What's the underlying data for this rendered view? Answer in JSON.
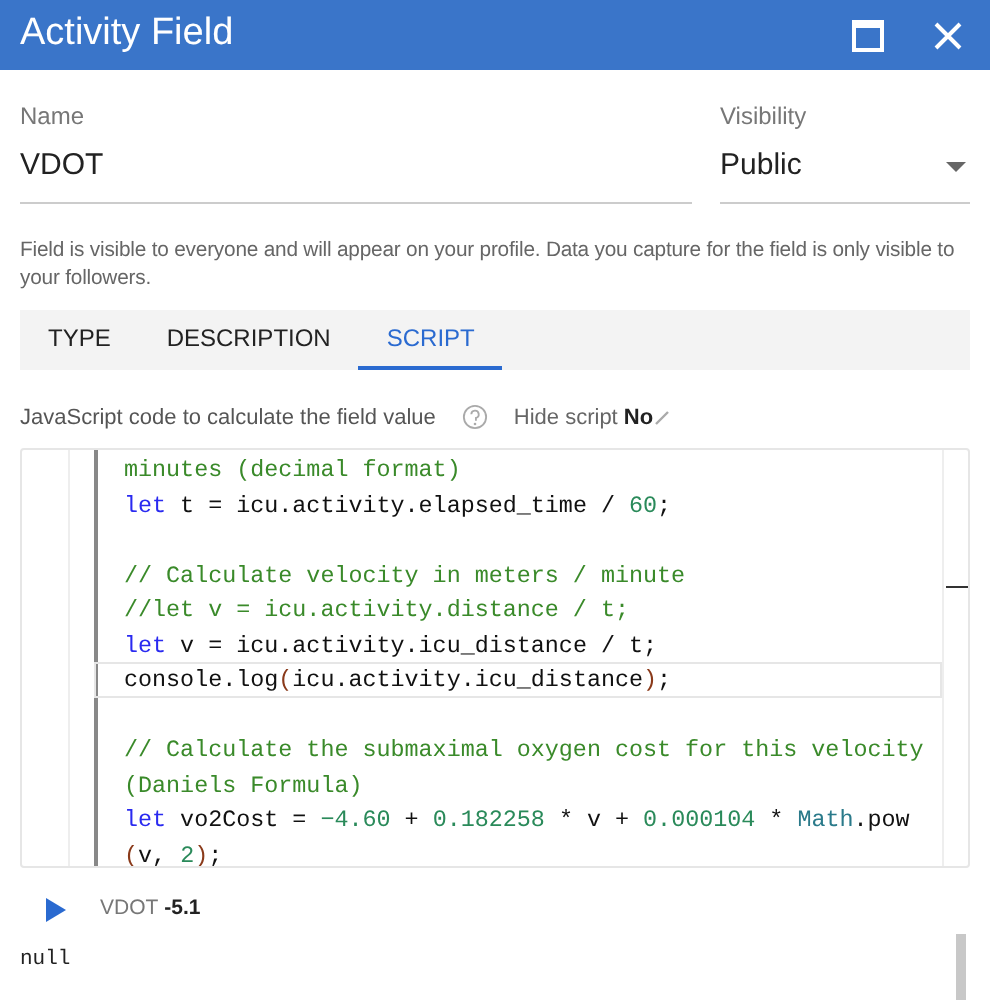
{
  "window": {
    "title": "Activity Field"
  },
  "name_field": {
    "label": "Name",
    "value": "VDOT"
  },
  "visibility_field": {
    "label": "Visibility",
    "value": "Public"
  },
  "description": "Field is visible to everyone and will appear on your profile. Data you capture for the field is only visible to your followers.",
  "tabs": [
    {
      "label": "TYPE",
      "selected": false
    },
    {
      "label": "DESCRIPTION",
      "selected": false
    },
    {
      "label": "SCRIPT",
      "selected": true
    }
  ],
  "script_label": "JavaScript code to calculate the field value",
  "hide_script": {
    "label": "Hide script",
    "value": "No"
  },
  "code_lines": [
    {
      "selected": false,
      "tokens": [
        {
          "kind": "comment",
          "text": "minutes (decimal format)"
        }
      ]
    },
    {
      "selected": false,
      "tokens": [
        {
          "kind": "keyword",
          "text": "let"
        },
        {
          "kind": "plain",
          "text": " t = icu.activity.elapsed_time / "
        },
        {
          "kind": "number",
          "text": "60"
        },
        {
          "kind": "plain",
          "text": ";"
        }
      ]
    },
    {
      "selected": false
    },
    {
      "selected": false,
      "tokens": [
        {
          "kind": "comment",
          "text": "// Calculate velocity in meters / minute"
        }
      ]
    },
    {
      "selected": false,
      "tokens": [
        {
          "kind": "comment",
          "text": "//let v = icu.activity.distance / t;"
        }
      ]
    },
    {
      "selected": false,
      "tokens": [
        {
          "kind": "keyword",
          "text": "let"
        },
        {
          "kind": "plain",
          "text": " v = icu.activity.icu_distance / t;"
        }
      ]
    },
    {
      "selected": true,
      "tokens": [
        {
          "kind": "plain",
          "text": "console.log"
        },
        {
          "kind": "paren",
          "text": "("
        },
        {
          "kind": "plain",
          "text": "icu.activity.icu_distance"
        },
        {
          "kind": "paren",
          "text": ")"
        },
        {
          "kind": "plain",
          "text": ";"
        }
      ]
    },
    {
      "selected": false
    },
    {
      "selected": false,
      "tokens": [
        {
          "kind": "comment",
          "text": "// Calculate the submaximal oxygen cost for this velocity"
        }
      ]
    },
    {
      "selected": false,
      "tokens": [
        {
          "kind": "comment",
          "text": "(Daniels Formula)"
        }
      ]
    },
    {
      "selected": false,
      "tokens": [
        {
          "kind": "keyword",
          "text": "let"
        },
        {
          "kind": "plain",
          "text": " vo2Cost = "
        },
        {
          "kind": "number",
          "text": "−4.60"
        },
        {
          "kind": "plain",
          "text": " + "
        },
        {
          "kind": "number",
          "text": "0.182258"
        },
        {
          "kind": "plain",
          "text": " * v + "
        },
        {
          "kind": "number",
          "text": "0.000104"
        },
        {
          "kind": "plain",
          "text": " * "
        },
        {
          "kind": "builtin",
          "text": "Math"
        },
        {
          "kind": "plain",
          "text": ".pow"
        }
      ]
    },
    {
      "selected": false,
      "tokens": [
        {
          "kind": "paren",
          "text": "("
        },
        {
          "kind": "plain",
          "text": "v, "
        },
        {
          "kind": "number",
          "text": "2"
        },
        {
          "kind": "paren",
          "text": ")"
        },
        {
          "kind": "plain",
          "text": ";"
        }
      ]
    }
  ],
  "result": {
    "label": "VDOT",
    "value": "-5.1"
  },
  "output": "null"
}
